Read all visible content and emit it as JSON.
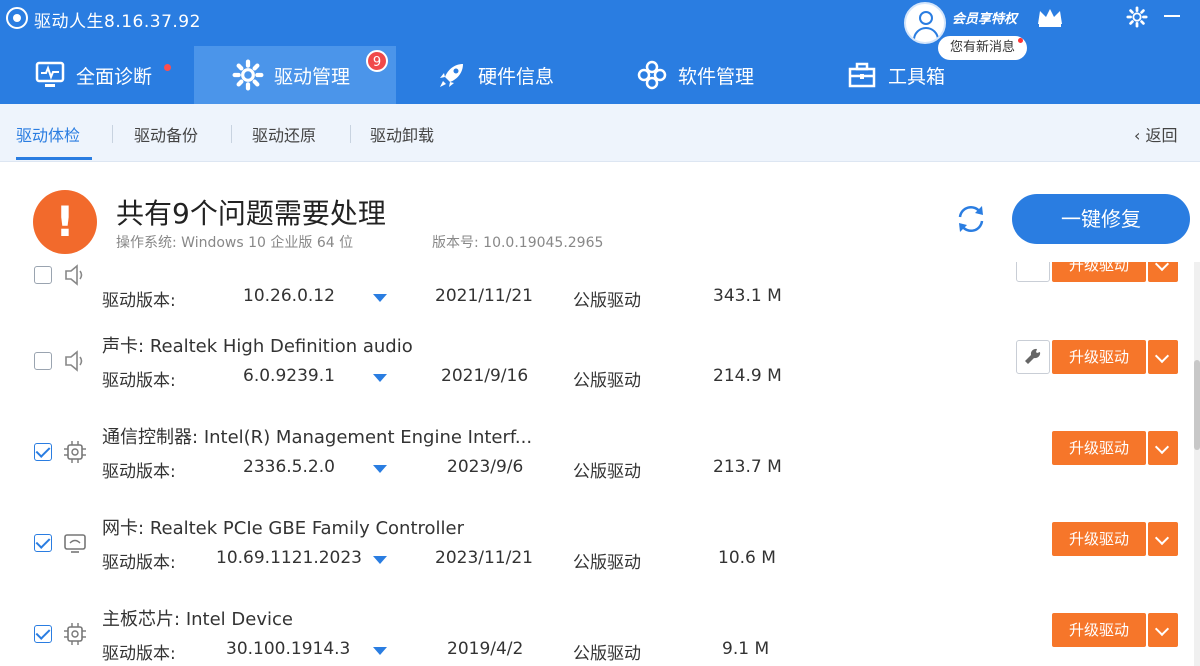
{
  "app": {
    "title": "驱动人生8.16.37.92"
  },
  "user": {
    "vip_label": "会员享特权",
    "message": "您有新消息"
  },
  "nav": {
    "items": [
      {
        "label": "全面诊断",
        "icon": "monitor-icon"
      },
      {
        "label": "驱动管理",
        "icon": "gear-icon",
        "badge": "9"
      },
      {
        "label": "硬件信息",
        "icon": "rocket-icon"
      },
      {
        "label": "软件管理",
        "icon": "flower-icon"
      },
      {
        "label": "工具箱",
        "icon": "toolbox-icon"
      }
    ]
  },
  "subtabs": {
    "items": [
      "驱动体检",
      "驱动备份",
      "驱动还原",
      "驱动卸载"
    ],
    "back": "返回"
  },
  "summary": {
    "title": "共有9个问题需要处理",
    "os_label": "操作系统: Windows 10 企业版 64 位",
    "build_label": "版本号: 10.0.19045.2965",
    "fix_button": "一键修复"
  },
  "rows": [
    {
      "category": "",
      "name": "",
      "version_label": "驱动版本:",
      "version": "10.26.0.12",
      "date": "2021/11/21",
      "type": "公版驱动",
      "size": "343.1 M",
      "checked": false,
      "icon": "speaker-icon",
      "wrench": true,
      "upgrade": "升级驱动"
    },
    {
      "category": "声卡:",
      "name": "Realtek High Definition audio",
      "version_label": "驱动版本:",
      "version": "6.0.9239.1",
      "date": "2021/9/16",
      "type": "公版驱动",
      "size": "214.9 M",
      "checked": false,
      "icon": "speaker-icon",
      "wrench": true,
      "upgrade": "升级驱动"
    },
    {
      "category": "通信控制器:",
      "name": "Intel(R) Management Engine Interf...",
      "version_label": "驱动版本:",
      "version": "2336.5.2.0",
      "date": "2023/9/6",
      "type": "公版驱动",
      "size": "213.7 M",
      "checked": true,
      "icon": "chip-icon",
      "wrench": false,
      "upgrade": "升级驱动"
    },
    {
      "category": "网卡:",
      "name": "Realtek PCIe GBE Family Controller",
      "version_label": "驱动版本:",
      "version": "10.69.1121.2023",
      "date": "2023/11/21",
      "type": "公版驱动",
      "size": "10.6 M",
      "checked": true,
      "icon": "network-icon",
      "wrench": false,
      "upgrade": "升级驱动"
    },
    {
      "category": "主板芯片:",
      "name": "Intel Device",
      "version_label": "驱动版本:",
      "version": "30.100.1914.3",
      "date": "2019/4/2",
      "type": "公版驱动",
      "size": "9.1 M",
      "checked": true,
      "icon": "chip-icon",
      "wrench": false,
      "upgrade": "升级驱动"
    }
  ],
  "colors": {
    "primary": "#2a7de1",
    "accent": "#f6762a",
    "alert": "#f26a2c"
  }
}
